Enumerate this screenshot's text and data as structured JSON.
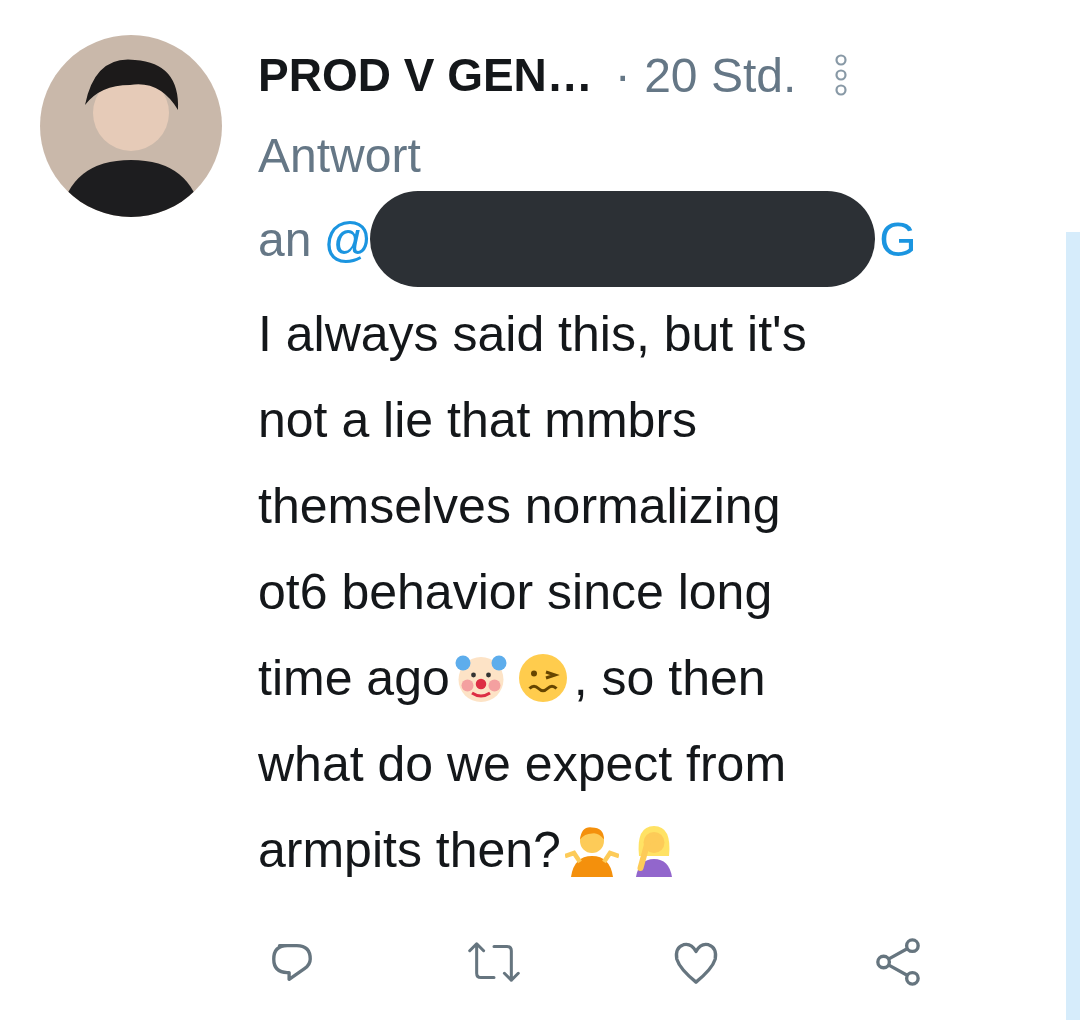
{
  "tweet": {
    "author": {
      "name": "PROD V GEN…",
      "time": "· 20 Std."
    },
    "reply_to": {
      "label": "Antwort",
      "prefix": "an",
      "handle_start": "@",
      "handle_end": "G"
    },
    "body_lines": [
      [
        {
          "kind": "text",
          "text": "I always said this, but it's"
        }
      ],
      [
        {
          "kind": "text",
          "text": "not a lie that mmbrs"
        }
      ],
      [
        {
          "kind": "text",
          "text": "themselves normalizing"
        }
      ],
      [
        {
          "kind": "text",
          "text": "ot6 behavior since long"
        }
      ],
      [
        {
          "kind": "text",
          "text": "time ago"
        },
        {
          "kind": "clown"
        },
        {
          "kind": "woozy"
        },
        {
          "kind": "text",
          "text": ", so then"
        }
      ],
      [
        {
          "kind": "text",
          "text": "what do we expect from"
        }
      ],
      [
        {
          "kind": "text",
          "text": "armpits then?"
        },
        {
          "kind": "shrug"
        },
        {
          "kind": "facepalm"
        }
      ]
    ],
    "actions": [
      {
        "kind": "reply"
      },
      {
        "kind": "retweet"
      },
      {
        "kind": "like"
      },
      {
        "kind": "share"
      }
    ]
  }
}
